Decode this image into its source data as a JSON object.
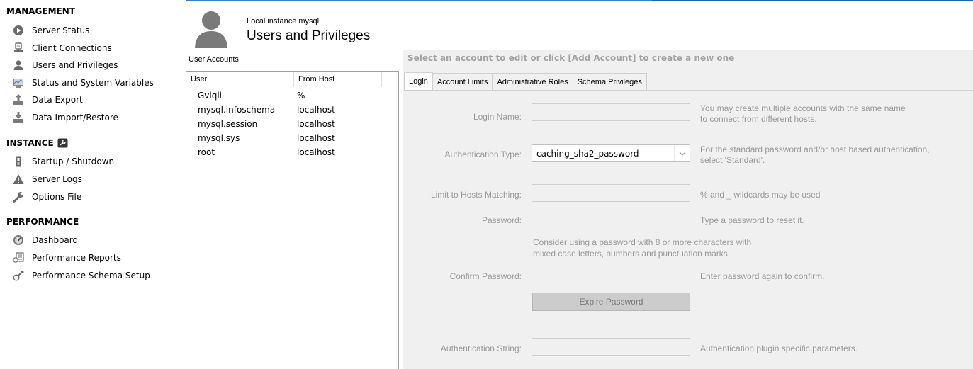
{
  "sidebar": {
    "management": {
      "title": "MANAGEMENT",
      "items": [
        {
          "label": "Server Status",
          "icon": "server-status-icon"
        },
        {
          "label": "Client Connections",
          "icon": "client-connections-icon"
        },
        {
          "label": "Users and Privileges",
          "icon": "users-icon"
        },
        {
          "label": "Status and System Variables",
          "icon": "variables-icon"
        },
        {
          "label": "Data Export",
          "icon": "export-icon"
        },
        {
          "label": "Data Import/Restore",
          "icon": "import-icon"
        }
      ]
    },
    "instance": {
      "title": "INSTANCE",
      "items": [
        {
          "label": "Startup / Shutdown",
          "icon": "startup-icon"
        },
        {
          "label": "Server Logs",
          "icon": "warning-icon"
        },
        {
          "label": "Options File",
          "icon": "wrench-icon"
        }
      ]
    },
    "performance": {
      "title": "PERFORMANCE",
      "items": [
        {
          "label": "Dashboard",
          "icon": "dashboard-icon"
        },
        {
          "label": "Performance Reports",
          "icon": "reports-icon"
        },
        {
          "label": "Performance Schema Setup",
          "icon": "schema-setup-icon"
        }
      ]
    }
  },
  "header": {
    "instance": "Local instance mysql",
    "title": "Users and Privileges"
  },
  "user_accounts": {
    "label": "User Accounts",
    "columns": [
      "User",
      "From Host"
    ],
    "rows": [
      {
        "user": "Gviqli",
        "host": "%"
      },
      {
        "user": "mysql.infoschema",
        "host": "localhost"
      },
      {
        "user": "mysql.session",
        "host": "localhost"
      },
      {
        "user": "mysql.sys",
        "host": "localhost"
      },
      {
        "user": "root",
        "host": "localhost"
      }
    ]
  },
  "editor": {
    "hint": "Select an account to edit or click [Add Account] to create a new one",
    "tabs": [
      "Login",
      "Account Limits",
      "Administrative Roles",
      "Schema Privileges"
    ],
    "login": {
      "login_name_label": "Login Name:",
      "login_name_note_1": "You may create multiple accounts with the same name",
      "login_name_note_2": "to connect from different hosts.",
      "auth_type_label": "Authentication Type:",
      "auth_type_value": "caching_sha2_password",
      "auth_type_note_1": "For the standard password and/or host based authentication,",
      "auth_type_note_2": "select 'Standard'.",
      "hosts_label": "Limit to Hosts Matching:",
      "hosts_note": "% and _ wildcards may be used",
      "password_label": "Password:",
      "password_note": "Type a password to reset it.",
      "password_hint_1": "Consider using a password with 8 or more characters with",
      "password_hint_2": "mixed case letters, numbers and punctuation marks.",
      "confirm_label": "Confirm Password:",
      "confirm_note": "Enter password again to confirm.",
      "expire_button": "Expire Password",
      "auth_string_label": "Authentication String:",
      "auth_string_note": "Authentication plugin specific parameters."
    }
  }
}
